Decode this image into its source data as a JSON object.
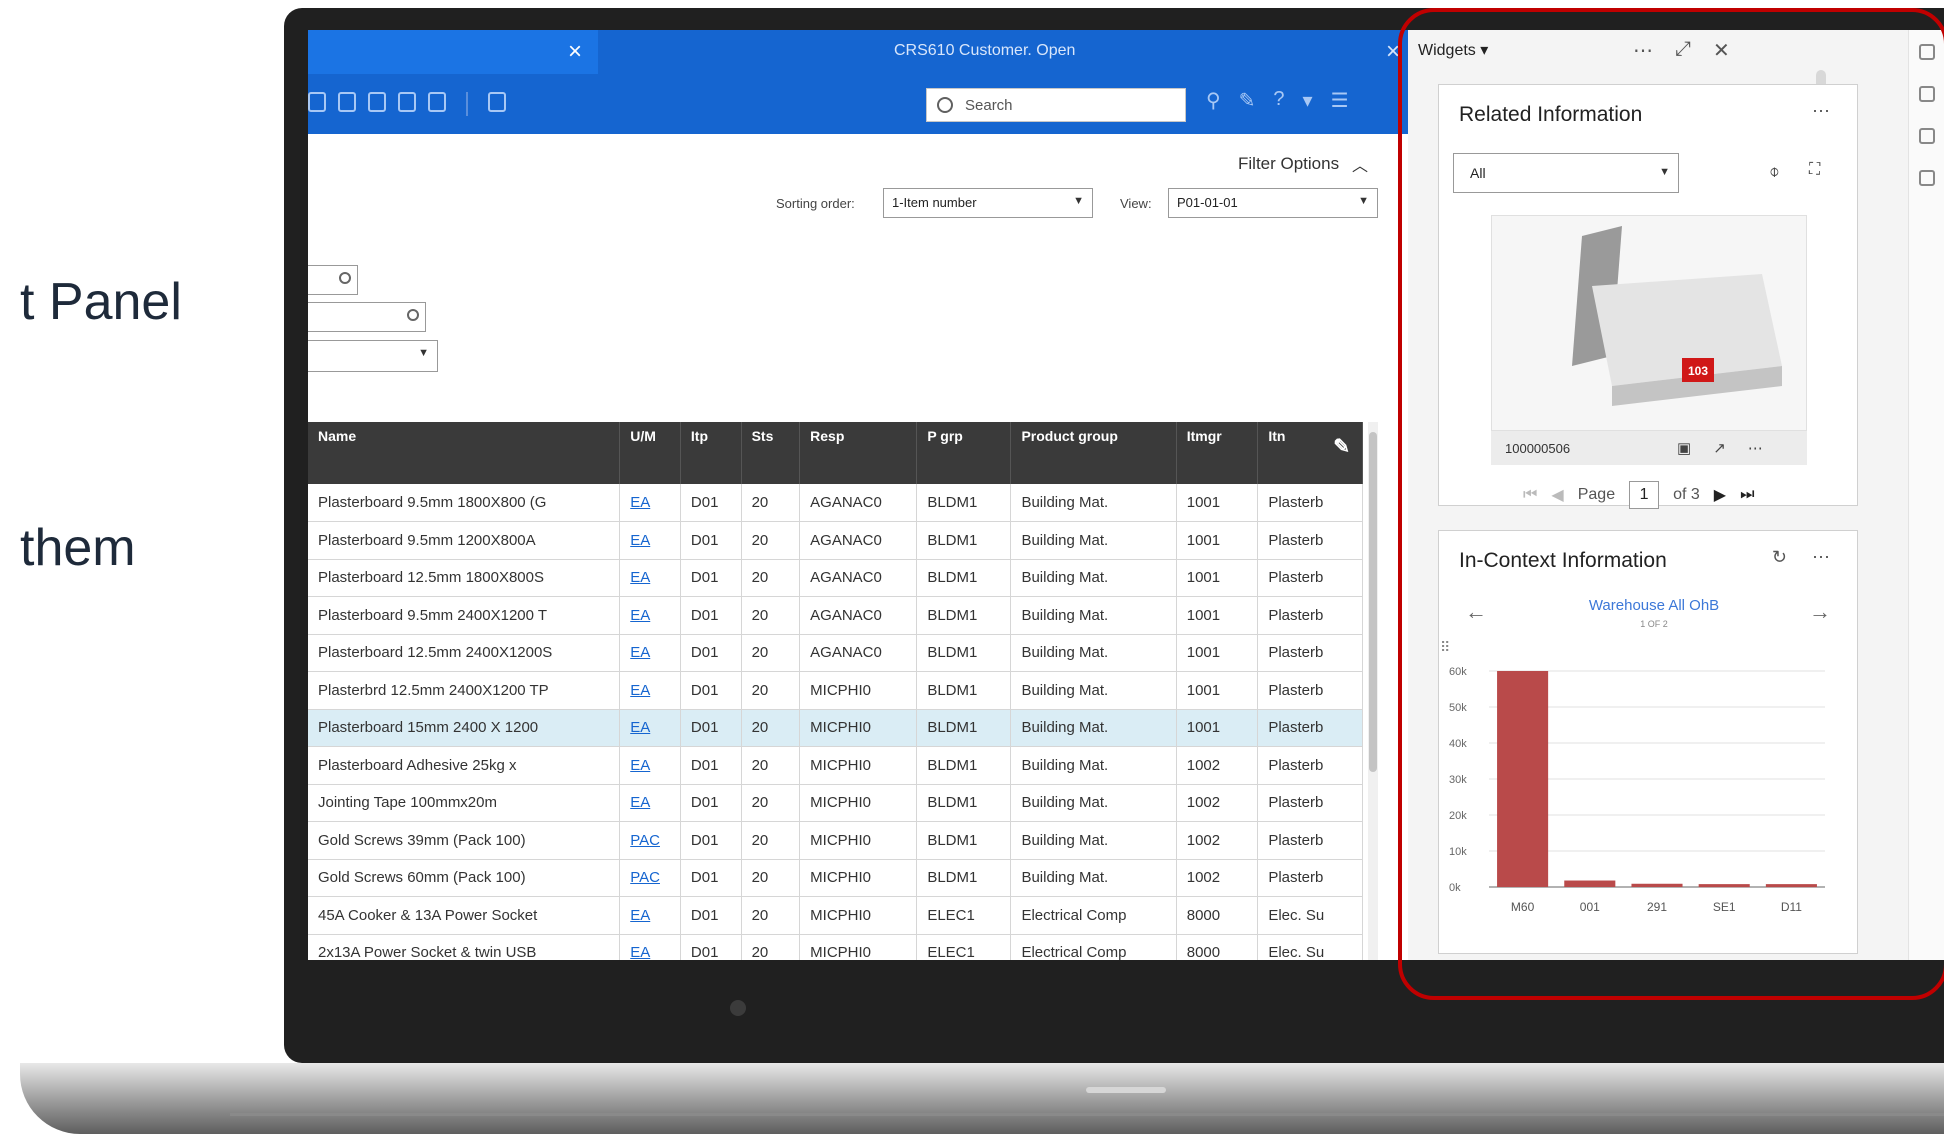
{
  "side_text": {
    "line1": "t Panel",
    "line2": "them"
  },
  "window": {
    "title": "CRS610 Customer. Open"
  },
  "toolbar": {
    "search_placeholder": "Search"
  },
  "filter": {
    "options_label": "Filter Options",
    "sorting_label": "Sorting order:",
    "sorting_value": "1-Item number",
    "view_label": "View:",
    "view_value": "P01-01-01"
  },
  "table": {
    "columns": [
      "Name",
      "U/M",
      "Itp",
      "Sts",
      "Resp",
      "P grp",
      "Product group",
      "Itmgr",
      "Itn"
    ],
    "rows": [
      [
        "Plasterboard 9.5mm 1800X800 (G",
        "EA",
        "D01",
        "20",
        "AGANAC0",
        "BLDM1",
        "Building Mat.",
        "1001",
        "Plasterb"
      ],
      [
        "Plasterboard 9.5mm 1200X800A",
        "EA",
        "D01",
        "20",
        "AGANAC0",
        "BLDM1",
        "Building Mat.",
        "1001",
        "Plasterb"
      ],
      [
        "Plasterboard 12.5mm 1800X800S",
        "EA",
        "D01",
        "20",
        "AGANAC0",
        "BLDM1",
        "Building Mat.",
        "1001",
        "Plasterb"
      ],
      [
        "Plasterboard 9.5mm 2400X1200 T",
        "EA",
        "D01",
        "20",
        "AGANAC0",
        "BLDM1",
        "Building Mat.",
        "1001",
        "Plasterb"
      ],
      [
        "Plasterboard 12.5mm 2400X1200S",
        "EA",
        "D01",
        "20",
        "AGANAC0",
        "BLDM1",
        "Building Mat.",
        "1001",
        "Plasterb"
      ],
      [
        "Plasterbrd 12.5mm 2400X1200 TP",
        "EA",
        "D01",
        "20",
        "MICPHI0",
        "BLDM1",
        "Building Mat.",
        "1001",
        "Plasterb"
      ],
      [
        "Plasterboard 15mm 2400 X 1200",
        "EA",
        "D01",
        "20",
        "MICPHI0",
        "BLDM1",
        "Building Mat.",
        "1001",
        "Plasterb"
      ],
      [
        "Plasterboard Adhesive 25kg x",
        "EA",
        "D01",
        "20",
        "MICPHI0",
        "BLDM1",
        "Building Mat.",
        "1002",
        "Plasterb"
      ],
      [
        "Jointing Tape 100mmx20m",
        "EA",
        "D01",
        "20",
        "MICPHI0",
        "BLDM1",
        "Building Mat.",
        "1002",
        "Plasterb"
      ],
      [
        "Gold Screws 39mm (Pack 100)",
        "PAC",
        "D01",
        "20",
        "MICPHI0",
        "BLDM1",
        "Building Mat.",
        "1002",
        "Plasterb"
      ],
      [
        "Gold Screws 60mm (Pack 100)",
        "PAC",
        "D01",
        "20",
        "MICPHI0",
        "BLDM1",
        "Building Mat.",
        "1002",
        "Plasterb"
      ],
      [
        "45A Cooker & 13A Power Socket",
        "EA",
        "D01",
        "20",
        "MICPHI0",
        "ELEC1",
        "Electrical Comp",
        "8000",
        "Elec. Su"
      ],
      [
        "2x13A Power Socket & twin USB",
        "EA",
        "D01",
        "20",
        "MICPHI0",
        "ELEC1",
        "Electrical Comp",
        "8000",
        "Elec. Su"
      ]
    ],
    "selected_row": 6
  },
  "widgets": {
    "header": "Widgets ▾",
    "related": {
      "title": "Related Information",
      "filter_value": "All",
      "item_id": "100000506",
      "badge": "103",
      "page_label": "Page",
      "page_current": "1",
      "page_total": "of 3"
    },
    "in_context": {
      "title": "In-Context Information",
      "subtitle": "Warehouse All OhB",
      "counter": "1 OF 2"
    }
  },
  "chart_data": {
    "type": "bar",
    "categories": [
      "M60",
      "001",
      "291",
      "SE1",
      "D11"
    ],
    "values": [
      60000,
      1800,
      900,
      800,
      800
    ],
    "yticks": [
      "0k",
      "10k",
      "20k",
      "30k",
      "40k",
      "50k",
      "60k"
    ],
    "ylim": [
      0,
      60000
    ],
    "color": "#b94a4a"
  }
}
